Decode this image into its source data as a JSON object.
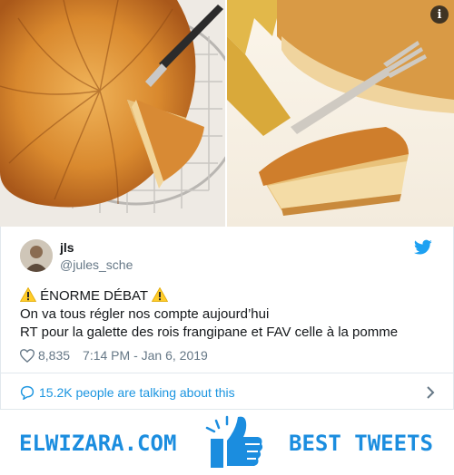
{
  "media": {
    "info_icon": "i"
  },
  "tweet": {
    "author_name": "jls",
    "author_handle": "@jules_sche",
    "lines": [
      "ÉNORME DÉBAT",
      "On va tous régler nos compte aujourd’hui",
      "RT pour la galette des rois frangipane et FAV celle à la pomme"
    ],
    "likes": "8,835",
    "timestamp": "7:14 PM - Jan 6, 2019",
    "talking": "15.2K people are talking about this"
  },
  "footer": {
    "brand": "ELWIZARA.COM",
    "tagline": "BEST TWEETS"
  },
  "colors": {
    "accent": "#1b95e0",
    "brand": "#1b8ddf",
    "muted": "#657786"
  }
}
